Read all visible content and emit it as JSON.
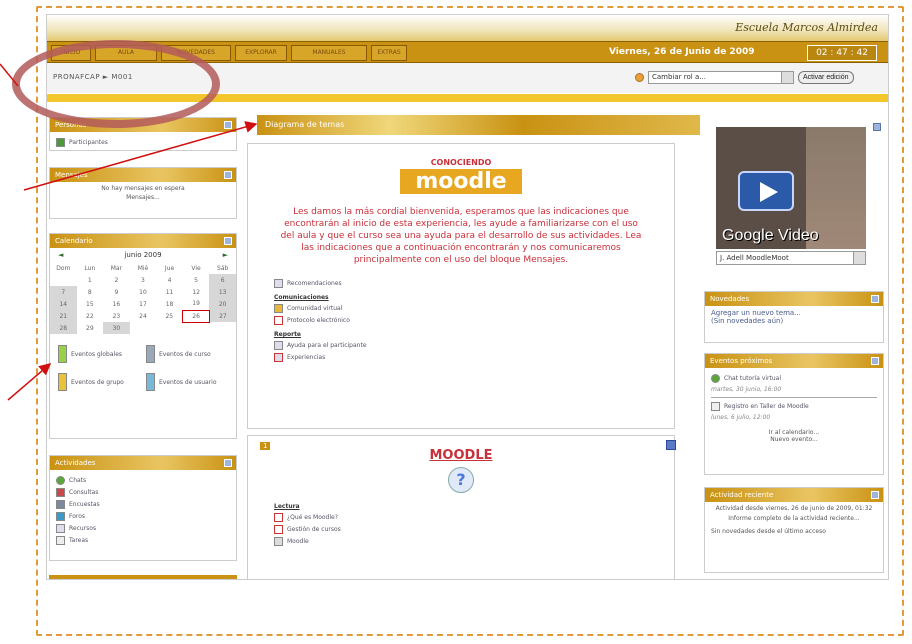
{
  "brand": "Escuela Marcos Almirdea",
  "nav": {
    "tabs": [
      "INICIO",
      "AULA",
      "NOVEDADES",
      "EXPLORAR",
      "MANUALES",
      "EXTRAS"
    ],
    "date": "Viernes, 26 de Junio de 2009",
    "clock": "02 : 47 : 42"
  },
  "breadcrumb": "PRONAFCAP ► M001",
  "role": {
    "select": "Cambiar rol a...",
    "edit_button": "Activar edición"
  },
  "left": {
    "personas": {
      "title": "Personas",
      "participants": "Participantes"
    },
    "mensajes": {
      "title": "Mensajes",
      "line1": "No hay mensajes en espera",
      "line2": "Mensajes..."
    },
    "calendario": {
      "title": "Calendario",
      "month": "junio 2009",
      "days": [
        "Dom",
        "Lun",
        "Mar",
        "Mié",
        "Jue",
        "Vie",
        "Sáb"
      ],
      "weeks": [
        [
          "",
          "1",
          "2",
          "3",
          "4",
          "5",
          "6"
        ],
        [
          "7",
          "8",
          "9",
          "10",
          "11",
          "12",
          "13"
        ],
        [
          "14",
          "15",
          "16",
          "17",
          "18",
          "19",
          "20"
        ],
        [
          "21",
          "22",
          "23",
          "24",
          "25",
          "26",
          "27"
        ],
        [
          "28",
          "29",
          "30",
          "",
          "",
          "",
          ""
        ]
      ],
      "events": [
        "Eventos globales",
        "Eventos de curso",
        "Eventos de grupo",
        "Eventos de usuario"
      ]
    },
    "actividades": {
      "title": "Actividades",
      "items": [
        "Chats",
        "Consultas",
        "Encuestas",
        "Foros",
        "Recursos",
        "Tareas"
      ]
    }
  },
  "center": {
    "program_title": "Diagrama de temas",
    "welcome_title": "CONOCIENDO",
    "logo": "moodle",
    "welcome_text": "Les damos la más cordial bienvenida, esperamos que las indicaciones que encontrarán al inicio de esta experiencia, les ayude a familiarizarse con el uso del aula y que el curso sea una ayuda para el desarrollo de sus actividades. Lea las indicaciones que a continuación encontrarán y nos comunicaremos principalmente con el uso del bloque Mensajes.",
    "links": [
      {
        "label": "Recomendaciones"
      },
      {
        "label": "Comunicaciones",
        "head": true
      },
      {
        "label": "Comunidad virtual"
      },
      {
        "label": "Protocolo electrónico"
      },
      {
        "label": "Reporte",
        "head": true
      },
      {
        "label": "Ayuda para el participante"
      },
      {
        "label": "Experiencias"
      }
    ],
    "section1": {
      "num": "1",
      "title": "MOODLE",
      "lectura": "Lectura",
      "items": [
        "¿Qué es Moodle?",
        "Gestión de cursos",
        "Moodle"
      ]
    }
  },
  "right": {
    "video": {
      "label": "Google Video",
      "select": "J. Adell MoodleMoot"
    },
    "novedades": {
      "title": "Novedades",
      "link": "Agregar un nuevo tema...",
      "empty": "(Sin novedades aún)"
    },
    "eventos": {
      "title": "Eventos próximos",
      "items": [
        {
          "name": "Chat tutoría virtual",
          "when": "martes, 30 junio, 16:00"
        },
        {
          "name": "Registro en Taller de Moodle",
          "when": "lunes, 6 julio, 12:00"
        }
      ],
      "goto": "Ir al calendario...",
      "new": "Nuevo evento..."
    },
    "actividad": {
      "title": "Actividad reciente",
      "since": "Actividad desde viernes, 26 de junio de 2009, 01:32",
      "full": "Informe completo de la actividad reciente...",
      "none": "Sin novedades desde el último acceso"
    }
  }
}
